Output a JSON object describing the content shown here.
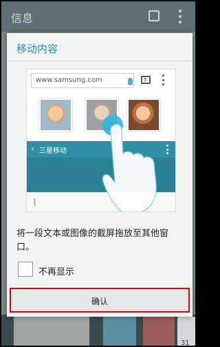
{
  "background_app": {
    "title": "信息",
    "calendar_badge": "31"
  },
  "dialog": {
    "title": "移动内容",
    "illustration": {
      "url": "www.samsung.com",
      "tab_count": "5",
      "app_bar_title": "三星移动"
    },
    "description": "将一段文本或图像的截屏拖放至其他窗口。",
    "checkbox_label": "不再显示",
    "checkbox_checked": false,
    "confirm_label": "确认"
  },
  "colors": {
    "accent": "#2d8aa8",
    "highlight_border": "#e00000",
    "touch_dot": "#2fb7e0"
  }
}
